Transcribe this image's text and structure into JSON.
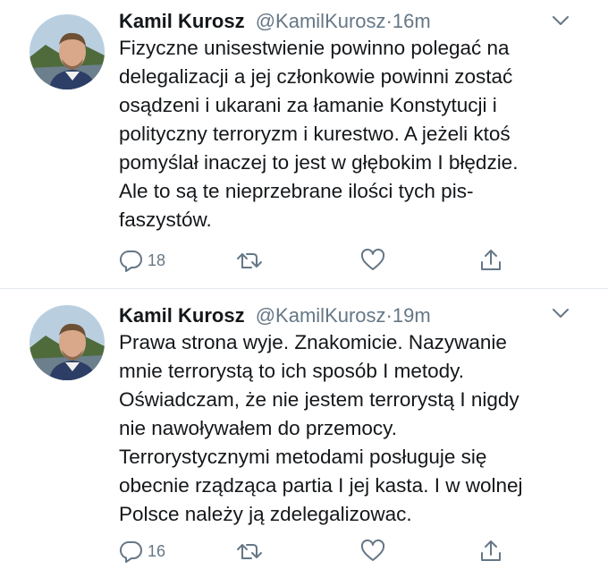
{
  "tweets": [
    {
      "author_name": "Kamil Kurosz",
      "handle": "@KamilKurosz",
      "separator": "·",
      "time": "16m",
      "lines": [
        "Fizyczne unisestwienie powinno polegać na",
        "delegalizacji a jej członkowie powinni zostać",
        "osądzeni i ukarani za łamanie Konstytucji i",
        "polityczny terroryzm i kurestwo. A jeżeli ktoś",
        "pomyślał inaczej to jest w głębokim I błędzie.",
        "Ale to są te nieprzebrane ilości tych pis-",
        "faszystów."
      ],
      "reply_count": "18",
      "retweet_count": "",
      "like_count": ""
    },
    {
      "author_name": "Kamil Kurosz",
      "handle": "@KamilKurosz",
      "separator": "·",
      "time": "19m",
      "lines": [
        "Prawa strona wyje. Znakomicie. Nazywanie",
        "mnie terrorystą to ich sposób I metody.",
        "Oświadczam, że nie jestem terrorystą I nigdy",
        "nie nawoływałem do przemocy.",
        "Terrorystycznymi metodami posługuje się",
        "obecnie rządząca partia I jej kasta. I w wolnej",
        "Polsce należy ją zdelegalizowac."
      ],
      "reply_count": "16",
      "retweet_count": "",
      "like_count": ""
    }
  ],
  "icons": {
    "reply": "reply-icon",
    "retweet": "retweet-icon",
    "like": "heart-icon",
    "share": "share-icon",
    "caret": "chevron-down-icon"
  },
  "colors": {
    "text": "#14171a",
    "secondary": "#657786",
    "divider": "#e1e8ed"
  }
}
